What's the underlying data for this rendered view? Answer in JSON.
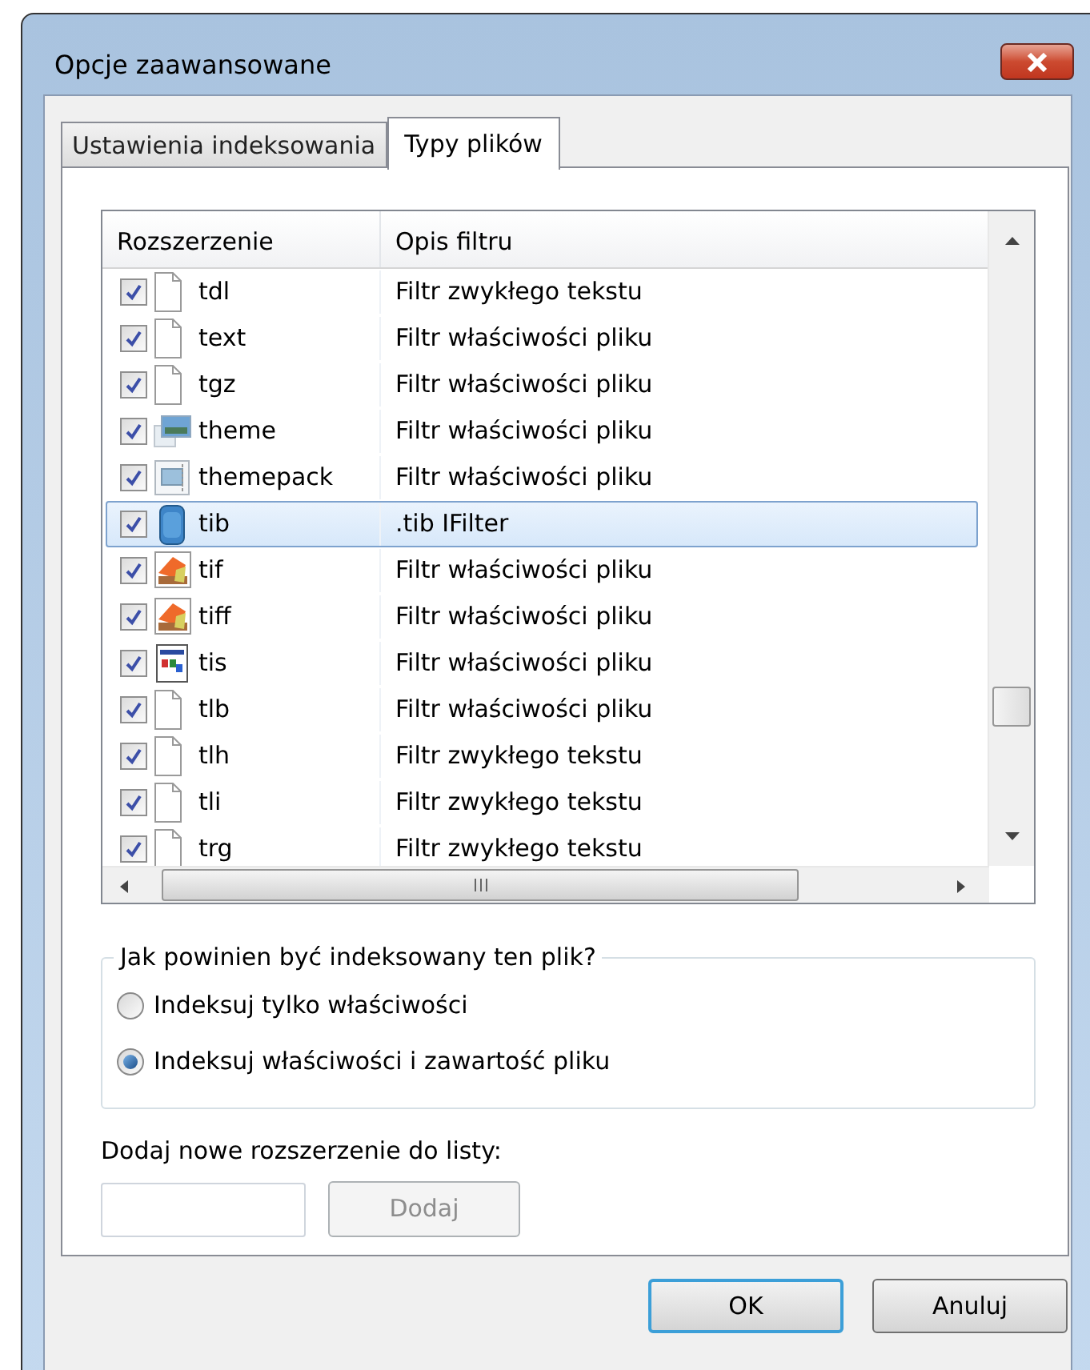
{
  "window": {
    "title": "Opcje zaawansowane"
  },
  "tabs": [
    {
      "label": "Ustawienia indeksowania",
      "selected": false
    },
    {
      "label": "Typy plików",
      "selected": true
    }
  ],
  "table": {
    "columns": [
      "Rozszerzenie",
      "Opis filtru"
    ],
    "rows": [
      {
        "extension": "tdl",
        "filter": "Filtr zwykłego tekstu",
        "kind": "blank",
        "checked": true,
        "selected": false
      },
      {
        "extension": "text",
        "filter": "Filtr właściwości pliku",
        "kind": "blank",
        "checked": true,
        "selected": false
      },
      {
        "extension": "tgz",
        "filter": "Filtr właściwości pliku",
        "kind": "blank",
        "checked": true,
        "selected": false
      },
      {
        "extension": "theme",
        "filter": "Filtr właściwości pliku",
        "kind": "theme",
        "checked": true,
        "selected": false
      },
      {
        "extension": "themepack",
        "filter": "Filtr właściwości pliku",
        "kind": "themepack",
        "checked": true,
        "selected": false
      },
      {
        "extension": "tib",
        "filter": ".tib IFilter",
        "kind": "disk",
        "checked": true,
        "selected": true
      },
      {
        "extension": "tif",
        "filter": "Filtr właściwości pliku",
        "kind": "image",
        "checked": true,
        "selected": false
      },
      {
        "extension": "tiff",
        "filter": "Filtr właściwości pliku",
        "kind": "image",
        "checked": true,
        "selected": false
      },
      {
        "extension": "tis",
        "filter": "Filtr właściwości pliku",
        "kind": "window",
        "checked": true,
        "selected": false
      },
      {
        "extension": "tlb",
        "filter": "Filtr właściwości pliku",
        "kind": "blank",
        "checked": true,
        "selected": false
      },
      {
        "extension": "tlh",
        "filter": "Filtr zwykłego tekstu",
        "kind": "blank",
        "checked": true,
        "selected": false
      },
      {
        "extension": "tli",
        "filter": "Filtr zwykłego tekstu",
        "kind": "blank",
        "checked": true,
        "selected": false
      },
      {
        "extension": "trg",
        "filter": "Filtr zwykłego tekstu",
        "kind": "blank",
        "checked": true,
        "selected": false
      }
    ]
  },
  "index_group": {
    "title": "Jak powinien być indeksowany ten plik?",
    "options": [
      {
        "label": "Indeksuj tylko właściwości",
        "selected": false
      },
      {
        "label": "Indeksuj właściwości i zawartość pliku",
        "selected": true
      }
    ]
  },
  "add_extension": {
    "label": "Dodaj nowe rozszerzenie do listy:",
    "button": "Dodaj",
    "disabled": true
  },
  "buttons": [
    {
      "label": "OK",
      "focused": true
    },
    {
      "label": "Anuluj",
      "focused": false
    }
  ]
}
